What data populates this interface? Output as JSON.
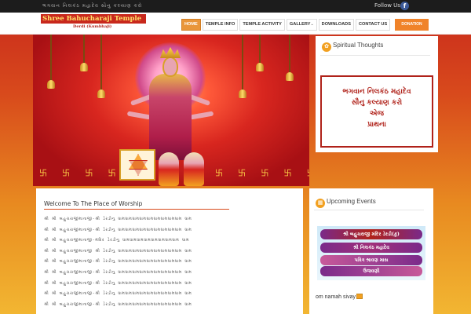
{
  "topbar": {
    "marquee": "ભગવાન નિલકંઠ મહાદેવ સૌનુ કલ્યાણ કરો",
    "follow_label": "Follow Us",
    "facebook_glyph": "f"
  },
  "header": {
    "logo_text": "Shree Bahucharaji Temple",
    "logo_sub": "Derdi (Kumbhaji)",
    "nav": [
      {
        "label": "HOME",
        "active": true
      },
      {
        "label": "TEMPLE INFO"
      },
      {
        "label": "TEMPLE ACTIVITY"
      },
      {
        "label": "GALLERY"
      },
      {
        "label": "DOWNLOADS"
      },
      {
        "label": "CONTACT US"
      }
    ],
    "gallery_chevron": "⌄",
    "donate_label": "DONATION"
  },
  "banner": {
    "swastika_glyph": "卐",
    "swastika_left": "卐 卐 卐 卐",
    "swastika_right": "卐 卐 卐 卐 卐 卐"
  },
  "spiritual": {
    "title": "Spiritual Thoughts",
    "icon": "lotus-icon",
    "lines": [
      "ભગવાન નિલકંઠ મહાદેવ",
      "સૌનુ કલ્યાણ કરો",
      "એજ",
      "પ્રાથના"
    ]
  },
  "welcome": {
    "title": "Welcome To The Place of Worship",
    "lines": [
      "શ્રી શ્રી બહુચરાજીમાતાજી-શ્રી ડેરડીનુ ધામધામધામધામધામધામધામધામધામ ધામ",
      "શ્રી શ્રી બહુચરાજીમાતાજી-શ્રી ડેરડીનુ ધામધામધામધામધામધામધામધામધામ ધામ",
      "શ્રી શ્રી બહુચરાજીમાતાજી-મંદિર ડેરડીનુ ધામધામધામધામધામધામધામધામ ધામ",
      "શ્રી શ્રી બહુચરાજીમાતાજી શ્રી ડેરડીનુ ધામધામધામધામધામધામધામધામધામ ધામ",
      "શ્રી શ્રી બહુચરાજીમાતાજી-શ્રી ડેરડીનુ ધામધામધામધામધામધામધામધામધામ ધામ",
      "શ્રી શ્રી બહુચરાજીમાતાજી-શ્રી ડેરડીનુ ધામધામધામધામધામધામધામધામધામ ધામ",
      "શ્રી શ્રી બહુચરાજીમાતાજી-શ્રી ડેરડીનુ ધામધામધામધામધામધામધામધામધામ ધામ",
      "શ્રી શ્રી બહુચરાજીમાતાજી-શ્રી ડેરડીનુ ધામધામધામધામધામધામધામધામધામ ધામ",
      "શ્રી શ્રી બહુચરાજીમાતાજી-શ્રી ડેરડીનુ ધામધામધામધામધામધામધામધામધામ ધામ"
    ]
  },
  "events": {
    "title": "Upcoming Events",
    "icon": "calendar-icon",
    "banner_lines": [
      "શ્રી બહુચરાજી મંદિર ડેરડી(કુ)",
      "શ્રી નિલકંઠ મહાદેવ",
      "પવિત્ર શ્રાવણ માસ",
      "ઉજવણી"
    ],
    "caption": "om namah sivay"
  }
}
